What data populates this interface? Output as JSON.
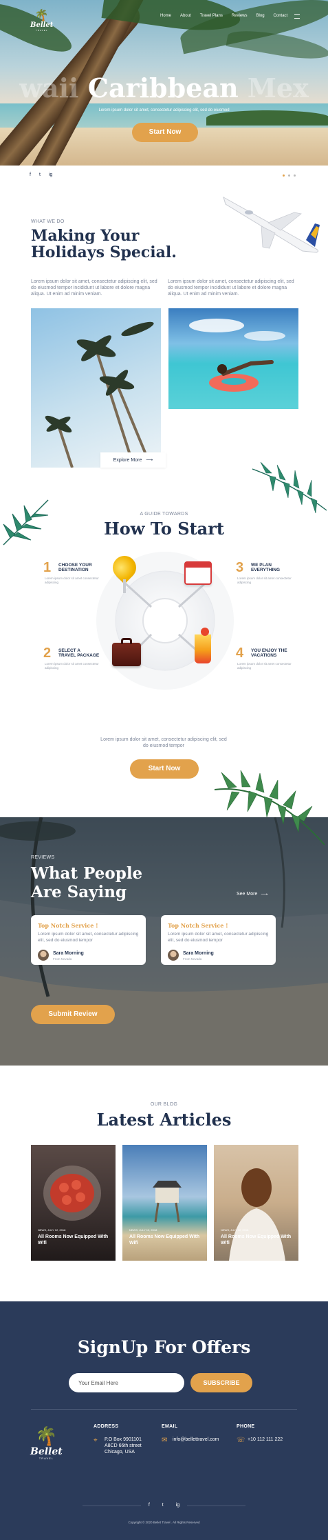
{
  "brand": {
    "name": "Bellet",
    "sub": "TRAVEL"
  },
  "nav": [
    "Home",
    "About",
    "Travel Plans",
    "Reviews",
    "Blog",
    "Contact"
  ],
  "hero": {
    "title_left": "waii",
    "title_main": "Caribbean",
    "title_right": "Mex",
    "subtitle": "Lorem ipsum dolor sit amet, consectetur adipiscing elit, sed do eiusmod",
    "cta": "Start Now",
    "social": [
      "f",
      "t",
      "ig"
    ]
  },
  "what_we_do": {
    "eyebrow": "WHAT WE DO",
    "title_line1": "Making Your",
    "title_line2": "Holidays Special.",
    "para1": "Lorem ipsum dolor sit amet, consectetur adipiscing elit, sed do eiusmod tempor incididunt ut labore et dolore magna aliqua. Ut enim ad minim veniam.",
    "para2": "Lorem ipsum dolor sit amet, consectetur adipiscing elit, sed do eiusmod tempor incididunt ut labore et dolore magna aliqua. Ut enim ad minim veniam.",
    "explore": "Explore More"
  },
  "how_to_start": {
    "eyebrow": "A GUIDE TOWARDS",
    "title": "How To Start",
    "steps": [
      {
        "num": "1",
        "title_l1": "CHOOSE YOUR",
        "title_l2": "DESTINATION",
        "desc": "Lorem ipsum dolor sit amet consectetur adipiscing"
      },
      {
        "num": "2",
        "title_l1": "SELECT A",
        "title_l2": "TRAVEL PACKAGE",
        "desc": "Lorem ipsum dolor sit amet consectetur adipiscing"
      },
      {
        "num": "3",
        "title_l1": "WE PLAN",
        "title_l2": "EVERYTHING",
        "desc": "Lorem ipsum dolor sit amet consectetur adipiscing"
      },
      {
        "num": "4",
        "title_l1": "YOU ENJOY THE",
        "title_l2": "VACATIONS",
        "desc": "Lorem ipsum dolor sit amet consectetur adipiscing"
      }
    ],
    "para": "Lorem ipsum dolor sit amet, consectetur adipiscing elit, sed do eiusmod tempor",
    "cta": "Start Now"
  },
  "reviews": {
    "eyebrow": "REVIEWS",
    "title_line1": "What People",
    "title_line2": "Are Saying",
    "see_more": "See More",
    "cards": [
      {
        "title": "Top Notch Service !",
        "body": "Lorem ipsum dolor sit amet, consectetur adipiscing elit, sed do eiusmod tempor",
        "name": "Sara Morning",
        "role": "From Nevada"
      },
      {
        "title": "Top Notch Service !",
        "body": "Lorem ipsum dolor sit amet, consectetur adipiscing elit, sed do eiusmod tempor",
        "name": "Sara Morning",
        "role": "From Nevada"
      }
    ],
    "cta": "Submit Review"
  },
  "blog": {
    "eyebrow": "OUR BLOG",
    "title": "Latest Articles",
    "articles": [
      {
        "meta": "NEWS, JULY 12, 2018",
        "title": "All Rooms Now Equipped With Wifi"
      },
      {
        "meta": "NEWS, JULY 12, 2018",
        "title": "All Rooms Now Equipped With Wifi"
      },
      {
        "meta": "NEWS, JULY 12, 2018",
        "title": "All Rooms Now Equipped With Wifi"
      }
    ]
  },
  "footer": {
    "signup_title": "SignUp For Offers",
    "email_placeholder": "Your Email Here",
    "subscribe": "SUBSCRIBE",
    "address_h": "ADDRESS",
    "address": [
      "P.O Box 9901101",
      "A8CD 66th street",
      "Chicago, USA"
    ],
    "email_h": "EMAIL",
    "email": "info@bellettravel.com",
    "phone_h": "PHONE",
    "phone": "+10 112 111 222",
    "social": [
      "f",
      "t",
      "ig"
    ],
    "copyright": "Copyright © 2020 Bellet Travel . All Rights Reserved"
  },
  "colors": {
    "accent": "#e2a24c",
    "navy": "#22324f",
    "footer": "#2b3b5a"
  }
}
